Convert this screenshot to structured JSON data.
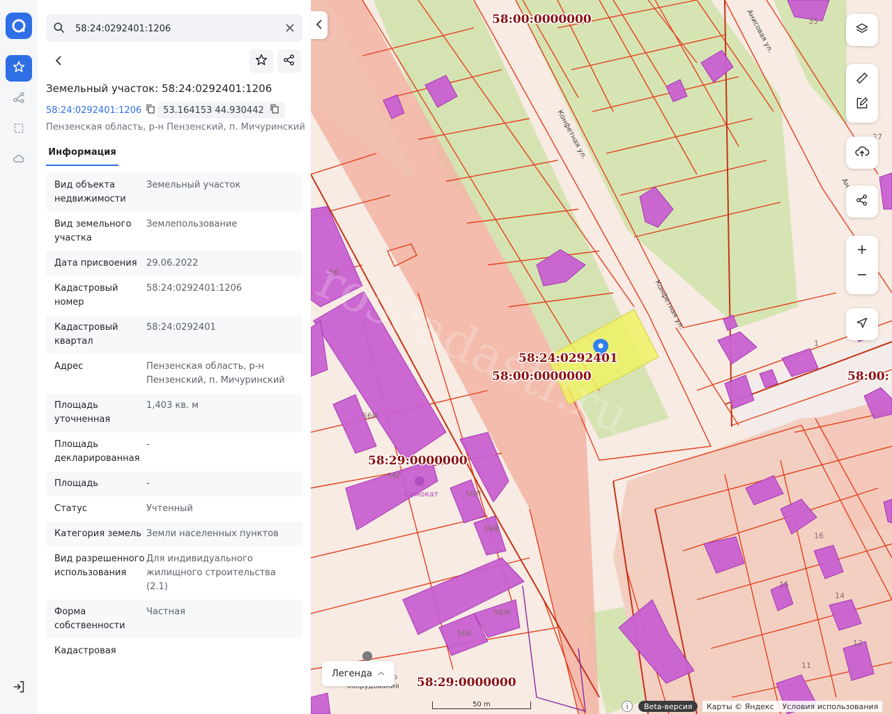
{
  "search": {
    "value": "58:24:0292401:1206"
  },
  "parcel": {
    "title": "Земельный участок: 58:24:0292401:1206",
    "cadastral_link": "58:24:0292401:1206",
    "coordinates": "53.164153 44.930442",
    "address": "Пензенская область, р-н Пензенский, п. Мичуринский"
  },
  "tabs": [
    {
      "label": "Информация"
    }
  ],
  "properties": [
    {
      "key": "Вид объекта недвижимости",
      "value": "Земельный участок"
    },
    {
      "key": "Вид земельного участка",
      "value": "Землепользование"
    },
    {
      "key": "Дата присвоения",
      "value": "29.06.2022"
    },
    {
      "key": "Кадастровый номер",
      "value": "58:24:0292401:1206"
    },
    {
      "key": "Кадастровый квартал",
      "value": "58:24:0292401"
    },
    {
      "key": "Адрес",
      "value": "Пензенская область, р-н Пензенский, п. Мичуринский"
    },
    {
      "key": "Площадь уточненная",
      "value": "1,403 кв. м"
    },
    {
      "key": "Площадь декларированная",
      "value": "-"
    },
    {
      "key": "Площадь",
      "value": "-"
    },
    {
      "key": "Статус",
      "value": "Учтенный"
    },
    {
      "key": "Категория земель",
      "value": "Земли населенных пунктов"
    },
    {
      "key": "Вид разрешенного использования",
      "value": "Для индивидуального жилищного строительства (2.1)"
    },
    {
      "key": "Форма собственности",
      "value": "Частная"
    },
    {
      "key": "Кадастровая",
      "value": ""
    }
  ],
  "map": {
    "quarter_labels": [
      "58:00:0000000",
      "58:24:0292401",
      "58:00:0000000",
      "58:29:0000000",
      "58:29:0000000",
      "58:00:"
    ],
    "streets": [
      "Анисовая ул.",
      "Конфетная ул.",
      "Конфетная ул.",
      "Ан",
      "ул."
    ],
    "house_numbers": [
      "35",
      "27",
      "56",
      "56И",
      "56Г",
      "56Л",
      "56В",
      "56Ж",
      "56Е",
      "1",
      "16",
      "15",
      "14",
      "12",
      "11"
    ],
    "poi": [
      "Самокат",
      "о",
      "оборудования"
    ],
    "watermark": "roscadastr.ru",
    "legend_label": "Легенда",
    "scale_label": "50 m",
    "beta_label": "Beta-версия",
    "attribution": "Карты © Яндекс",
    "terms": "Условия использования",
    "info": "i"
  },
  "colors": {
    "accent": "#2f6fe6",
    "parcel_line": "#e1401f",
    "building": "#c45fd0",
    "selected": "#eef264",
    "greenery": "#d4e3b1"
  },
  "icons": [
    "logo-icon",
    "star-icon",
    "route-icon",
    "select-area-icon",
    "cloud-icon",
    "search-icon",
    "close-icon",
    "back-icon",
    "share-icon",
    "copy-icon",
    "exit-icon",
    "layers-icon",
    "ruler-icon",
    "edit-icon",
    "upload-icon",
    "zoom-in-icon",
    "zoom-out-icon",
    "navigate-icon",
    "map-pin-icon"
  ]
}
